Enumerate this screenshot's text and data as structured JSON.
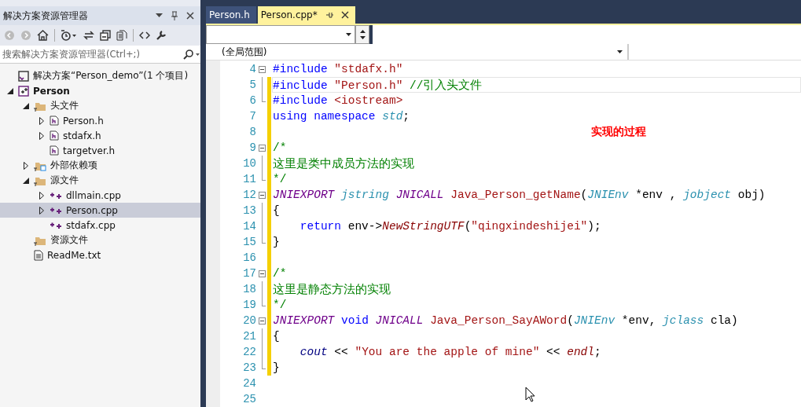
{
  "explorer": {
    "title": "解决方案资源管理器",
    "search": {
      "placeholder": "搜索解决方案资源管理器(Ctrl+;)"
    },
    "tree": [
      {
        "kind": "solution",
        "label": "解决方案“Person_demo”(1 个项目)",
        "selected": false
      },
      {
        "kind": "project",
        "label": "Person",
        "expanded": true,
        "selected": false,
        "children": [
          {
            "kind": "folder",
            "label": "头文件",
            "expanded": true,
            "selected": false,
            "children": [
              {
                "kind": "header",
                "label": "Person.h",
                "expanded": false,
                "selected": false
              },
              {
                "kind": "header",
                "label": "stdafx.h",
                "expanded": false,
                "selected": false
              },
              {
                "kind": "header",
                "label": "targetver.h",
                "selected": false
              }
            ]
          },
          {
            "kind": "deps",
            "label": "外部依赖项",
            "expanded": false,
            "selected": false
          },
          {
            "kind": "folder",
            "label": "源文件",
            "expanded": true,
            "selected": false,
            "children": [
              {
                "kind": "cpp",
                "label": "dllmain.cpp",
                "expanded": false,
                "selected": false
              },
              {
                "kind": "cpp",
                "label": "Person.cpp",
                "expanded": false,
                "selected": true
              },
              {
                "kind": "cpp",
                "label": "stdafx.cpp",
                "selected": false
              }
            ]
          },
          {
            "kind": "folder",
            "label": "资源文件",
            "selected": false
          },
          {
            "kind": "text",
            "label": "ReadMe.txt",
            "selected": false
          }
        ]
      }
    ]
  },
  "tabs": [
    {
      "label": "Person.h",
      "selected": false
    },
    {
      "label": "Person.cpp*",
      "selected": true
    }
  ],
  "scope": "(全局范围)",
  "annotation": "实现的过程",
  "code": [
    {
      "number": "4",
      "kind": "fold_start",
      "changed": false,
      "current": false,
      "tokens": [
        {
          "kind": "pre",
          "text": "#include "
        },
        {
          "kind": "str",
          "text": "\"stdafx.h\""
        }
      ]
    },
    {
      "number": "5",
      "kind": "fold_mid",
      "changed": true,
      "current": true,
      "tokens": [
        {
          "kind": "pre",
          "text": "#include "
        },
        {
          "kind": "str",
          "text": "\"Person.h\""
        },
        {
          "kind": "com",
          "text": " //引入头文件"
        }
      ]
    },
    {
      "number": "6",
      "kind": "fold_end",
      "changed": true,
      "current": false,
      "tokens": [
        {
          "kind": "pre",
          "text": "#include "
        },
        {
          "kind": "str",
          "text": "<iostream>"
        }
      ]
    },
    {
      "number": "7",
      "kind": "plain",
      "changed": true,
      "current": false,
      "tokens": [
        {
          "kind": "kw",
          "text": "using namespace "
        },
        {
          "kind": "type",
          "text": "std"
        },
        {
          "kind": "plain",
          "text": ";"
        }
      ]
    },
    {
      "number": "8",
      "kind": "plain",
      "changed": true,
      "current": false
    },
    {
      "number": "9",
      "kind": "fold_start",
      "changed": true,
      "current": false,
      "tokens": [
        {
          "kind": "com",
          "text": "/*"
        }
      ]
    },
    {
      "number": "10",
      "kind": "fold_mid",
      "changed": true,
      "current": false,
      "tokens": [
        {
          "kind": "com",
          "text": "这里是类中成员方法的实现"
        }
      ]
    },
    {
      "number": "11",
      "kind": "fold_end",
      "changed": true,
      "current": false,
      "tokens": [
        {
          "kind": "com",
          "text": "*/"
        }
      ]
    },
    {
      "number": "12",
      "kind": "fold_start",
      "changed": true,
      "current": false,
      "tokens": [
        {
          "kind": "macro",
          "text": "JNIEXPORT "
        },
        {
          "kind": "type",
          "text": "jstring "
        },
        {
          "kind": "macro",
          "text": "JNICALL"
        },
        {
          "kind": "fn",
          "text": " Java_Person_getName"
        },
        {
          "kind": "plain",
          "text": "("
        },
        {
          "kind": "type",
          "text": "JNIEnv"
        },
        {
          "kind": "plain",
          "text": " *env , "
        },
        {
          "kind": "type",
          "text": "jobject"
        },
        {
          "kind": "plain",
          "text": " obj)"
        }
      ]
    },
    {
      "number": "13",
      "kind": "fold_mid",
      "changed": true,
      "current": false,
      "tokens": [
        {
          "kind": "plain",
          "text": "{"
        }
      ]
    },
    {
      "number": "14",
      "kind": "fold_mid",
      "changed": true,
      "current": false,
      "tokens": [
        {
          "kind": "kw",
          "text": "    return "
        },
        {
          "kind": "plain",
          "text": "env->"
        },
        {
          "kind": "call",
          "text": "NewStringUTF"
        },
        {
          "kind": "plain",
          "text": "("
        },
        {
          "kind": "str",
          "text": "\"qingxindeshijei\""
        },
        {
          "kind": "plain",
          "text": ");"
        }
      ]
    },
    {
      "number": "15",
      "kind": "fold_end",
      "changed": true,
      "current": false,
      "tokens": [
        {
          "kind": "plain",
          "text": "}"
        }
      ]
    },
    {
      "number": "16",
      "kind": "plain",
      "changed": true,
      "current": false
    },
    {
      "number": "17",
      "kind": "fold_start",
      "changed": true,
      "current": false,
      "tokens": [
        {
          "kind": "com",
          "text": "/*"
        }
      ]
    },
    {
      "number": "18",
      "kind": "fold_mid",
      "changed": true,
      "current": false,
      "tokens": [
        {
          "kind": "com",
          "text": "这里是静态方法的实现"
        }
      ]
    },
    {
      "number": "19",
      "kind": "fold_end",
      "changed": true,
      "current": false,
      "tokens": [
        {
          "kind": "com",
          "text": "*/"
        }
      ]
    },
    {
      "number": "20",
      "kind": "fold_start",
      "changed": true,
      "current": false,
      "tokens": [
        {
          "kind": "macro",
          "text": "JNIEXPORT"
        },
        {
          "kind": "kw",
          "text": " void "
        },
        {
          "kind": "macro",
          "text": "JNICALL"
        },
        {
          "kind": "fn",
          "text": " Java_Person_SayAWord"
        },
        {
          "kind": "plain",
          "text": "("
        },
        {
          "kind": "type",
          "text": "JNIEnv"
        },
        {
          "kind": "plain",
          "text": " *env, "
        },
        {
          "kind": "type",
          "text": "jclass"
        },
        {
          "kind": "plain",
          "text": " cla)"
        }
      ]
    },
    {
      "number": "21",
      "kind": "fold_mid",
      "changed": true,
      "current": false,
      "tokens": [
        {
          "kind": "plain",
          "text": "{"
        }
      ]
    },
    {
      "number": "22",
      "kind": "fold_mid",
      "changed": true,
      "current": false,
      "tokens": [
        {
          "kind": "glob",
          "text": "    cout"
        },
        {
          "kind": "plain",
          "text": " << "
        },
        {
          "kind": "str",
          "text": "\"You are the apple of mine\""
        },
        {
          "kind": "plain",
          "text": " << "
        },
        {
          "kind": "call",
          "text": "endl"
        },
        {
          "kind": "plain",
          "text": ";"
        }
      ]
    },
    {
      "number": "23",
      "kind": "fold_end",
      "changed": true,
      "current": false,
      "tokens": [
        {
          "kind": "plain",
          "text": "}"
        }
      ]
    },
    {
      "number": "24",
      "kind": "plain",
      "changed": false,
      "current": false
    },
    {
      "number": "25",
      "kind": "plain",
      "changed": false,
      "current": false
    }
  ]
}
